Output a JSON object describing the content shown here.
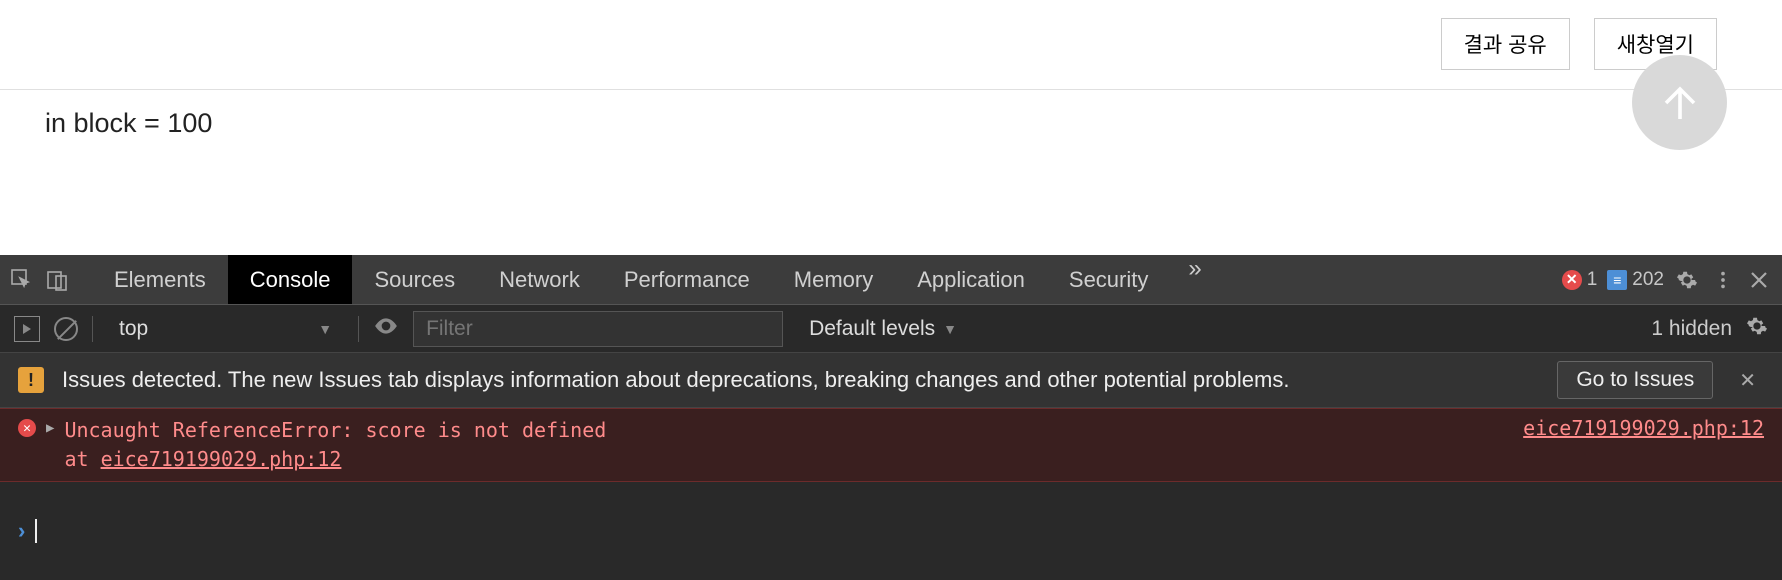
{
  "top": {
    "shareButton": "결과 공유",
    "newWindowButton": "새창열기"
  },
  "content": {
    "text": "in block = 100"
  },
  "devtools": {
    "tabs": {
      "elements": "Elements",
      "console": "Console",
      "sources": "Sources",
      "network": "Network",
      "performance": "Performance",
      "memory": "Memory",
      "application": "Application",
      "security": "Security"
    },
    "errorCount": "1",
    "warningCount": "202",
    "toolbar": {
      "context": "top",
      "filterPlaceholder": "Filter",
      "levels": "Default levels",
      "hiddenText": "1 hidden"
    },
    "issues": {
      "message": "Issues detected. The new Issues tab displays information about deprecations, breaking changes and other potential problems.",
      "goButton": "Go to Issues"
    },
    "error": {
      "message": "Uncaught ReferenceError: score is not defined",
      "stackPrefix": "    at ",
      "stackLink": "eice719199029.php:12",
      "sourceLink": "eice719199029.php:12"
    }
  }
}
